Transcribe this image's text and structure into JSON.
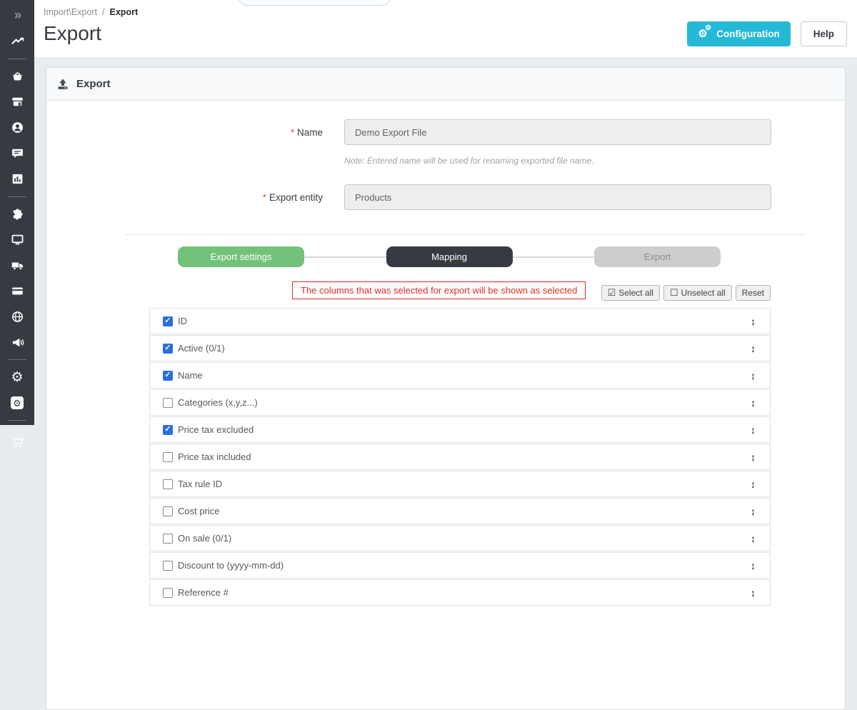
{
  "colors": {
    "accent_teal": "#25b9d7",
    "step_done_green": "#72c279",
    "step_active_dark": "#363a41",
    "step_pending_gray": "#cdcdcd",
    "checkbox_checked_blue": "#2a6fe0",
    "notice_red": "#e02b27",
    "sidebar_bg": "#363a41"
  },
  "header": {
    "breadcrumb": {
      "section": "Import\\Export",
      "separator": "/",
      "current": "Export"
    },
    "title": "Export",
    "configuration_button": "Configuration",
    "help_button": "Help"
  },
  "sidebar": {
    "icons": [
      "collapse-double-chevron",
      "trending-up",
      "shopping-basket",
      "storefront",
      "customer-account",
      "chat-bubble",
      "bar-chart",
      "puzzle-module",
      "monitor-design",
      "delivery-truck",
      "payment-card",
      "globe-international",
      "megaphone-marketing",
      "gear-settings",
      "gear-advanced",
      "shopping-cart"
    ]
  },
  "panel": {
    "title": "Export",
    "form": {
      "required_mark": "*",
      "name_label": "Name",
      "name_value": "Demo Export File",
      "name_note": "Note: Entered name will be used for renaming exported file name.",
      "entity_label": "Export entity",
      "entity_value": "Products"
    },
    "stepper": {
      "steps": [
        {
          "label": "Export settings",
          "state": "done"
        },
        {
          "label": "Mapping",
          "state": "active"
        },
        {
          "label": "Export",
          "state": "pending"
        }
      ]
    },
    "mapping": {
      "notice": "The columns that was selected for export will be shown as selected",
      "select_all_label": "Select all",
      "unselect_all_label": "Unselect all",
      "reset_label": "Reset",
      "columns": [
        {
          "label": "ID",
          "checked": true
        },
        {
          "label": "Active (0/1)",
          "checked": true
        },
        {
          "label": "Name",
          "checked": true
        },
        {
          "label": "Categories (x,y,z...)",
          "checked": false
        },
        {
          "label": "Price tax excluded",
          "checked": true
        },
        {
          "label": "Price tax included",
          "checked": false
        },
        {
          "label": "Tax rule ID",
          "checked": false
        },
        {
          "label": "Cost price",
          "checked": false
        },
        {
          "label": "On sale (0/1)",
          "checked": false
        },
        {
          "label": "Discount to (yyyy-mm-dd)",
          "checked": false
        },
        {
          "label": "Reference #",
          "checked": false
        }
      ]
    }
  }
}
